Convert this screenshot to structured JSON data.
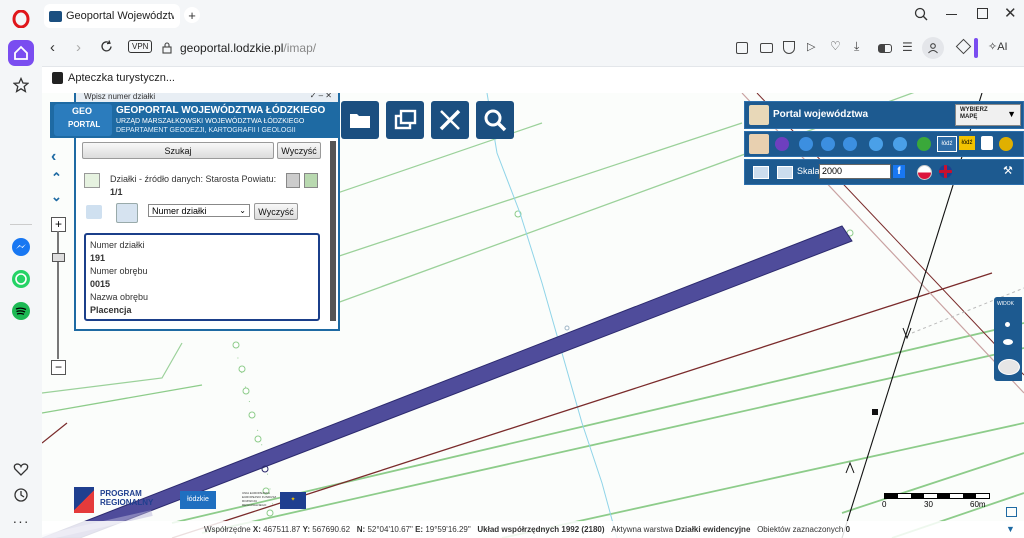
{
  "browser": {
    "tab_title": "Geoportal Województwa Ł",
    "vpn_label": "VPN",
    "url_domain": "geoportal.lodzkie.pl",
    "url_path": "/imap/",
    "ai_label": "AI",
    "bookmark": "Apteczka turystyczn..."
  },
  "toolbar_icons": [
    "folder-icon",
    "windows-icon",
    "measure-icon",
    "search-icon"
  ],
  "panel": {
    "header_top": "Wpisz numer działki",
    "title": "GEOPORTAL WOJEWÓDZTWA ŁÓDZKIEGO",
    "subtitle": "URZĄD MARSZAŁKOWSKI WOJEWÓDZTWA ŁÓDZKIEGO",
    "department": "DEPARTAMENT GEODEZJI, KARTOGRAFII I GEOLOGII",
    "logo_geo": "GEO",
    "logo_portal": "PORTAL",
    "search_btn": "Szukaj",
    "clear_btn": "Wyczyść",
    "source": "Działki - źródło danych: Starosta Powiatu:",
    "count": "1/1",
    "select_value": "Numer działki",
    "clear_btn2": "Wyczyść",
    "result": {
      "label1": "Numer działki",
      "value1": "191",
      "label2": "Numer obrębu",
      "value2": "0015",
      "label3": "Nazwa obrębu",
      "value3": "Placencja"
    }
  },
  "right_panel": {
    "title": "Portal województwa",
    "choose_map": "WYBIERZ MAPĘ",
    "scale_label": "Skala",
    "scale_value": "2000",
    "lodz_btn": "łódź",
    "lodz_btn2": "łódź",
    "widok": "WIDOK"
  },
  "scalebar": {
    "l0": "0",
    "l1": "30",
    "l2": "60m"
  },
  "logos": {
    "program": "PROGRAM",
    "regionalny": "REGIONALNY",
    "lodzkie": "łódzkie",
    "ue": "UNIA EUROPEJSKA EUROPEJSKI FUNDUSZ ROZWOJU REGIONALNEGO"
  },
  "status": {
    "coords_label": "Współrzędne",
    "x_label": "X:",
    "x_val": "467511.87",
    "y_label": "Y:",
    "y_val": "567690.62",
    "n_label": "N:",
    "n_val": "52°04'10.67\"",
    "e_label": "E:",
    "e_val": "19°59'16.29\"",
    "system": "Układ współrzędnych 1992 (2180)",
    "layer_label": "Aktywna warstwa",
    "layer_val": "Działki ewidencyjne",
    "selected_label": "Obiektów zaznaczonych",
    "selected_val": "0"
  }
}
